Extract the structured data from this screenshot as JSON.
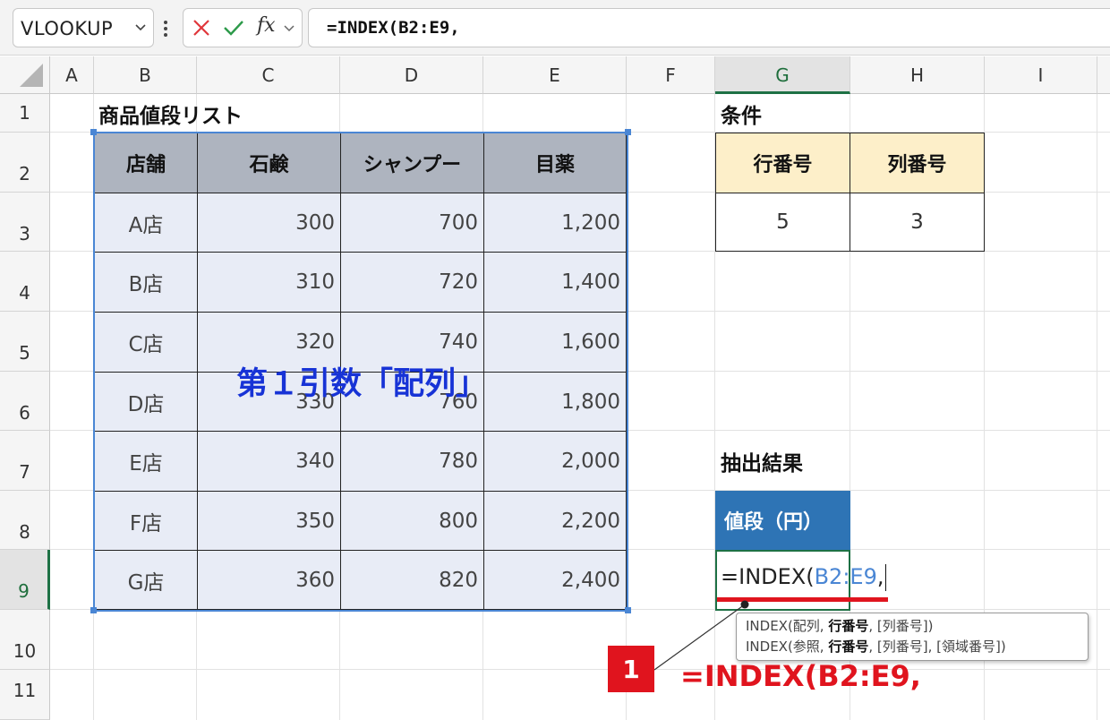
{
  "formula_bar": {
    "name_box": "VLOOKUP",
    "fx_label": "fx",
    "formula": "=INDEX(B2:E9,"
  },
  "columns": [
    "A",
    "B",
    "C",
    "D",
    "E",
    "F",
    "G",
    "H",
    "I"
  ],
  "rows": [
    "1",
    "2",
    "3",
    "4",
    "5",
    "6",
    "7",
    "8",
    "9",
    "10",
    "11"
  ],
  "table": {
    "title": "商品値段リスト",
    "headers": [
      "店舗",
      "石鹸",
      "シャンプー",
      "目薬"
    ],
    "rows": [
      [
        "A店",
        "300",
        "700",
        "1,200"
      ],
      [
        "B店",
        "310",
        "720",
        "1,400"
      ],
      [
        "C店",
        "320",
        "740",
        "1,600"
      ],
      [
        "D店",
        "330",
        "760",
        "1,800"
      ],
      [
        "E店",
        "340",
        "780",
        "2,000"
      ],
      [
        "F店",
        "350",
        "800",
        "2,200"
      ],
      [
        "G店",
        "360",
        "820",
        "2,400"
      ]
    ],
    "overlay_label": "第１引数「配列」"
  },
  "conditions": {
    "title": "条件",
    "headers": [
      "行番号",
      "列番号"
    ],
    "values": [
      "5",
      "3"
    ]
  },
  "result": {
    "title": "抽出結果",
    "header": "値段（円）",
    "edit_prefix": "=INDEX(",
    "edit_ref": "B2:E9",
    "edit_suffix": ","
  },
  "tooltip": {
    "line1_a": "INDEX(配列, ",
    "line1_b": "行番号",
    "line1_c": ", [列番号])",
    "line2_a": "INDEX(参照, ",
    "line2_b": "行番号",
    "line2_c": ", [列番号], [領域番号])"
  },
  "annotation": {
    "badge": "1",
    "formula": "=INDEX(B2:E9,"
  },
  "colors": {
    "accent_green": "#1e7145",
    "table_header": "#aeb4bf",
    "table_body": "#e8ecf6",
    "condition_header": "#fdefc9",
    "result_header": "#2e74b5",
    "ref_blue": "#4a86d4",
    "annotation_red": "#e0141e"
  }
}
